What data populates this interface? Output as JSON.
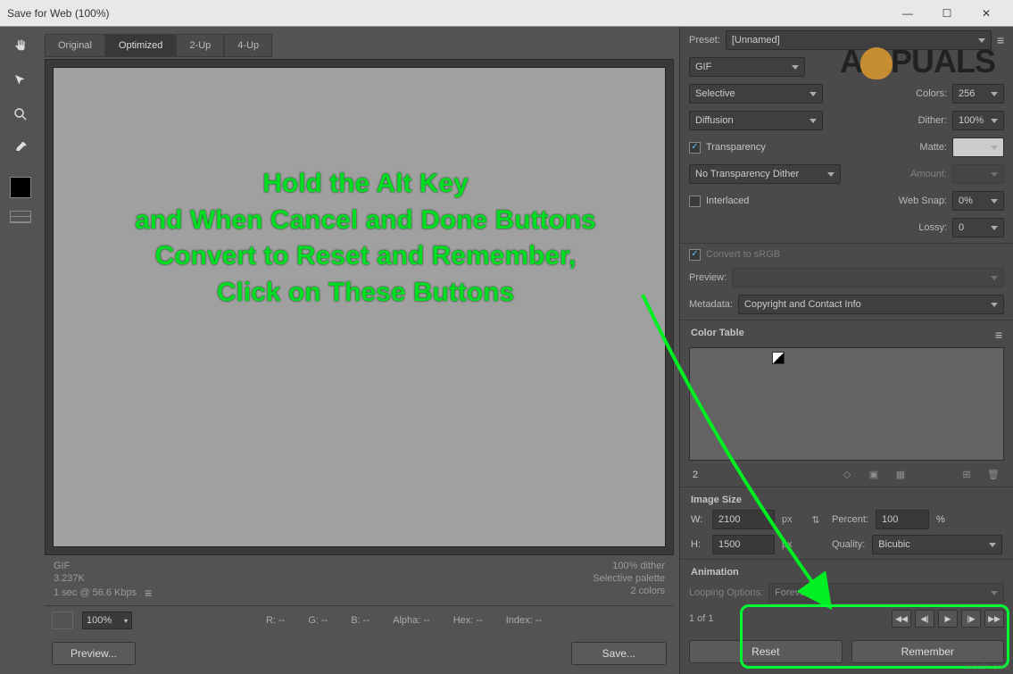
{
  "title": "Save for Web (100%)",
  "tabs": {
    "original": "Original",
    "optimized": "Optimized",
    "twoUp": "2-Up",
    "fourUp": "4-Up"
  },
  "info": {
    "format": "GIF",
    "size": "3.237K",
    "speed": "1 sec @ 56.6 Kbps",
    "ditherPct": "100% dither",
    "palette": "Selective palette",
    "colors": "2 colors"
  },
  "pixrow": {
    "zoom": "100%",
    "r": "R: --",
    "g": "G: --",
    "b": "B: --",
    "alpha": "Alpha: --",
    "hex": "Hex: --",
    "index": "Index: --"
  },
  "buttons": {
    "preview": "Preview...",
    "save": "Save...",
    "reset": "Reset",
    "remember": "Remember"
  },
  "preset": {
    "label": "Preset:",
    "value": "[Unnamed]",
    "format": "GIF",
    "reduction": "Selective",
    "colorsLabel": "Colors:",
    "colors": "256",
    "ditherMethod": "Diffusion",
    "ditherLabel": "Dither:",
    "dither": "100%",
    "transparency": "Transparency",
    "matteLabel": "Matte:",
    "transDither": "No Transparency Dither",
    "amountLabel": "Amount:",
    "interlaced": "Interlaced",
    "webSnapLabel": "Web Snap:",
    "webSnap": "0%",
    "lossyLabel": "Lossy:",
    "lossy": "0"
  },
  "convert": {
    "title": "Convert to sRGB",
    "previewLabel": "Preview:"
  },
  "metadata": {
    "label": "Metadata:",
    "value": "Copyright and Contact Info"
  },
  "colorTable": {
    "label": "Color Table",
    "count": "2"
  },
  "imageSize": {
    "title": "Image Size",
    "wLabel": "W:",
    "w": "2100",
    "pxW": "px",
    "hLabel": "H:",
    "h": "1500",
    "pxH": "px",
    "percentLabel": "Percent:",
    "percent": "100",
    "pct": "%",
    "qualityLabel": "Quality:",
    "quality": "Bicubic"
  },
  "animation": {
    "title": "Animation",
    "loopLabel": "Looping Options:",
    "loop": "Forever",
    "status": "1 of 1"
  },
  "annotation": {
    "l1": "Hold the Alt Key",
    "l2": "and When Cancel and Done Buttons",
    "l3": "Convert to Reset and Remember,",
    "l4": "Click on These Buttons"
  },
  "watermark": {
    "a": "A",
    "puals": "PUALS",
    "src": "wsxdn.com"
  }
}
